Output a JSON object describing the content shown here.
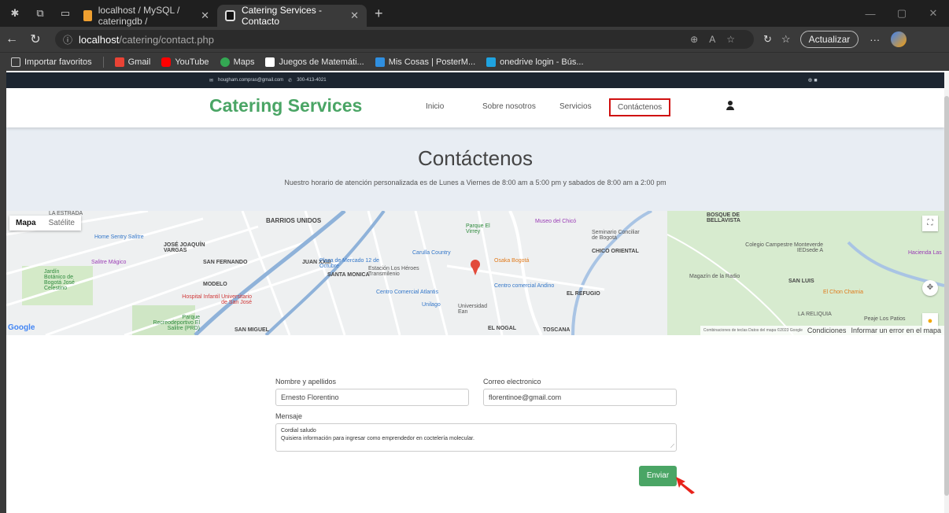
{
  "browser": {
    "tabs": [
      {
        "title": "localhost / MySQL / cateringdb /",
        "active": false
      },
      {
        "title": "Catering Services - Contacto",
        "active": true
      }
    ],
    "url_host": "localhost",
    "url_path": "/catering/contact.php",
    "update_label": "Actualizar",
    "bookmarks": [
      "Importar favoritos",
      "Gmail",
      "YouTube",
      "Maps",
      "Juegos de Matemáti...",
      "Mis Cosas | PosterM...",
      "onedrive login - Bús..."
    ]
  },
  "topbar": {
    "email": "hougham.compras@gmail.com",
    "phone": "300-413-4021"
  },
  "navbar": {
    "brand": "Catering Services",
    "links": [
      "Inicio",
      "Sobre nosotros",
      "Servicios",
      "Contáctenos"
    ],
    "active": "Contáctenos"
  },
  "hero": {
    "title": "Contáctenos",
    "subtitle": "Nuestro horario de atención personalizada es de Lunes a Viernes de 8:00 am a 5:00 pm y sabados de 8:00 am a 2:00 pm"
  },
  "map": {
    "type_map": "Mapa",
    "type_sat": "Satélite",
    "google": "Google",
    "footer_small": "Combinaciones de teclas   Datos del mapa ©2023 Google",
    "footer_terms": "Condiciones",
    "footer_report": "Informar un error en el mapa",
    "labels": {
      "barrios": "BARRIOS UNIDOS",
      "bellavista": "BOSQUE DE BELLAVISTA",
      "home_sentry": "Home Sentry Salitre",
      "joaquin": "JOSÉ JOAQUÍN VARGAS",
      "salitre_magico": "Salitre Mágico",
      "san_fernando": "SAN FERNANDO",
      "jardin": "Jardín Botánico de Bogotá José Celestino",
      "modelo": "MODELO",
      "juan_xxiii": "JUAN XXIII",
      "plaza": "Plaza de Mercado 12 de Octubre",
      "santa_monica": "SANTA MONICA",
      "estacion": "Estación Los Héroes Transmilenio",
      "carulla": "Carulla Country",
      "osaka": "Osaka Bogotá",
      "hospital": "Hospital Infantil Universitario de San José",
      "atlantis": "Centro Comercial Atlantis",
      "andino": "Centro comercial Andino",
      "unilago": "Unilago",
      "universidad": "Universidad Ean",
      "parque_virrey": "Parque El Virrey",
      "museo": "Museo del Chicó",
      "seminario": "Seminario Conciliar de Bogotá",
      "chico": "CHICO ORIENTAL",
      "refugio": "EL REFUGIO",
      "colegio": "Colegio Campestre Monteverde IEDsede A",
      "magazin": "Magazín de la Radio",
      "san_luis": "SAN LUIS",
      "chon": "El Chon Chamia",
      "hacienda": "Hacienda Las",
      "reliquia": "LA RELIQUIA",
      "peaje": "Peaje Los Patios",
      "san_miguel": "SAN MIGUEL",
      "parque_salitre": "Parque Recreodeportivo El Salitre (PRD)",
      "nogal": "EL NOGAL",
      "toscana": "TOSCANA",
      "estrada": "LA ESTRADA"
    }
  },
  "form": {
    "name_label": "Nombre y apellidos",
    "name_value": "Ernesto Florentino",
    "email_label": "Correo electronico",
    "email_value": "florentinoe@gmail.com",
    "message_label": "Mensaje",
    "message_line1": "Cordial saludo",
    "message_line2": "Quisiera información para ingresar como emprendedor en coctelería molecular.",
    "submit": "Enviar"
  }
}
